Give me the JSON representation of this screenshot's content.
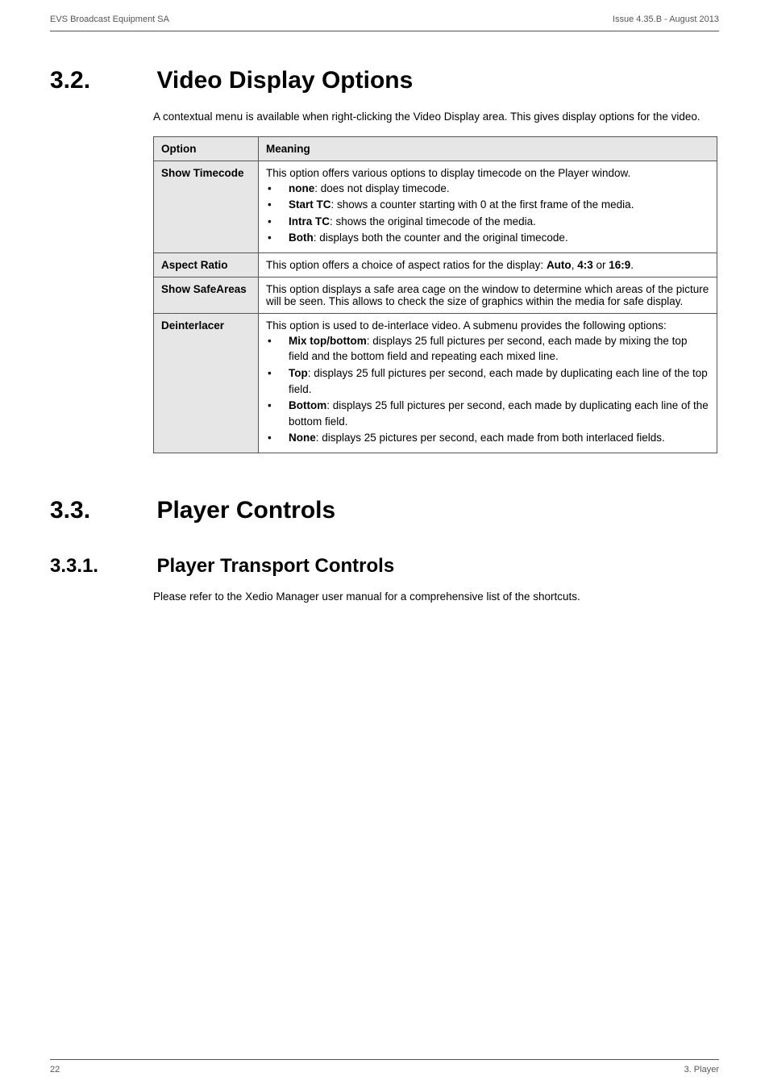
{
  "header": {
    "left": "EVS Broadcast Equipment SA",
    "right": "Issue 4.35.B - August 2013"
  },
  "sec32": {
    "num": "3.2.",
    "title": "Video Display Options",
    "intro": "A contextual menu is available when right-clicking the Video Display area. This gives display options for the video.",
    "table": {
      "h_option": "Option",
      "h_meaning": "Meaning",
      "rows": [
        {
          "label": "Show Timecode",
          "lead": "This option offers various options to display timecode on the Player window.",
          "bullets": [
            {
              "b": "none",
              "t": ": does not display timecode."
            },
            {
              "b": "Start TC",
              "t": ": shows a counter starting with 0 at the first frame of the media."
            },
            {
              "b": "Intra TC",
              "t": ": shows the original timecode of the media."
            },
            {
              "b": "Both",
              "t": ": displays both the counter and the original timecode."
            }
          ]
        },
        {
          "label": "Aspect Ratio",
          "plain_pre": "This option offers a choice of aspect ratios for the display: ",
          "plain_bold1": "Auto",
          "plain_mid": ", ",
          "plain_bold2": "4:3",
          "plain_post1": " or ",
          "plain_bold3": "16:9",
          "plain_post2": "."
        },
        {
          "label": "Show SafeAreas",
          "plain": "This option displays a safe area cage on the window to determine which areas of the picture will be seen. This allows to check the size of graphics within the media for safe display."
        },
        {
          "label": "Deinterlacer",
          "lead": "This option is used to de-interlace video. A submenu provides the following options:",
          "bullets": [
            {
              "b": "Mix top/bottom",
              "t": ": displays 25 full pictures per second, each made by mixing the top field and the bottom field and repeating each mixed line."
            },
            {
              "b": "Top",
              "t": ": displays 25 full pictures per second, each made by duplicating each line of the top field."
            },
            {
              "b": "Bottom",
              "t": ": displays 25 full pictures per second, each made by duplicating each line of the bottom field."
            },
            {
              "b": "None",
              "t": ": displays 25 pictures per second, each made from both interlaced fields."
            }
          ]
        }
      ]
    }
  },
  "sec33": {
    "num": "3.3.",
    "title": "Player Controls"
  },
  "sec331": {
    "num": "3.3.1.",
    "title": "Player Transport Controls",
    "body": "Please refer to the Xedio Manager user manual for a comprehensive list of the shortcuts."
  },
  "footer": {
    "left": "22",
    "right": "3. Player"
  }
}
